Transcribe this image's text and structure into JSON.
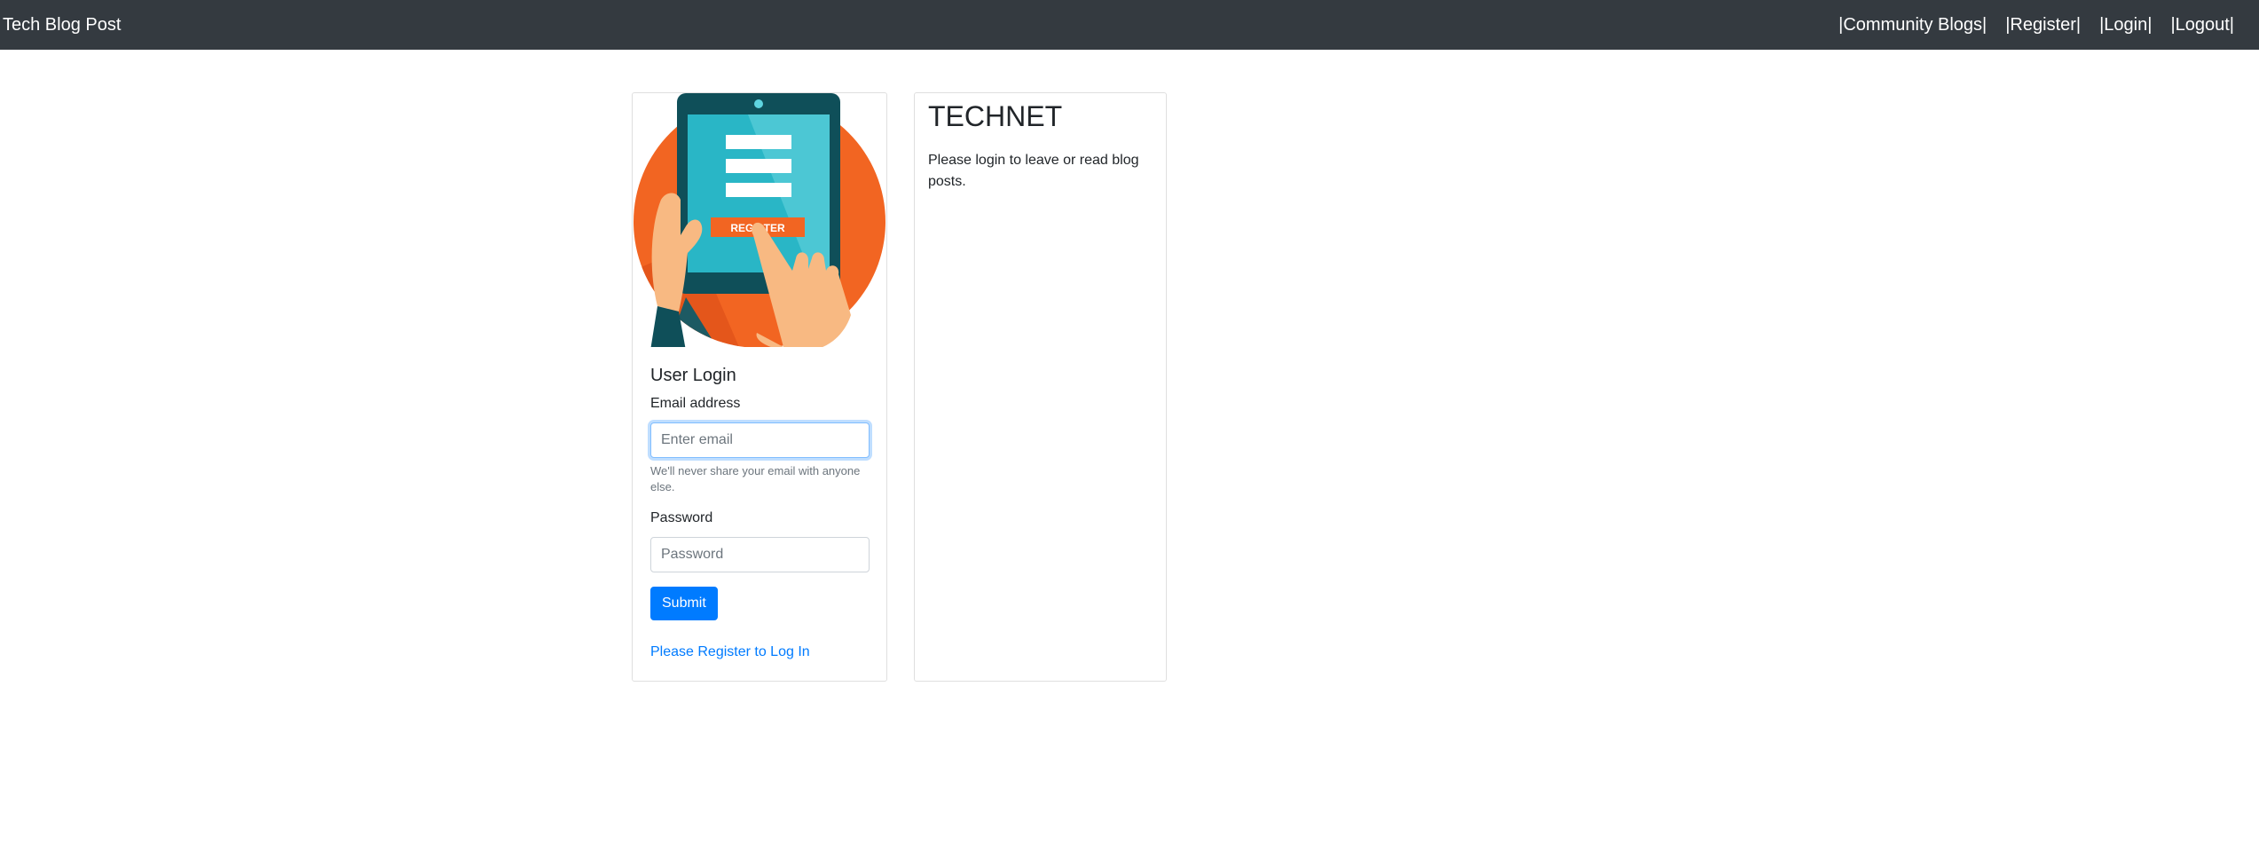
{
  "navbar": {
    "brand": "Tech Blog Post",
    "links": [
      "|Community Blogs|",
      "|Register|",
      "|Login|",
      "|Logout|"
    ],
    "background": "#343a40"
  },
  "login": {
    "illustration_label": "REGISTER",
    "title": "User Login",
    "email_label": "Email address",
    "email_placeholder": "Enter email",
    "email_value": "",
    "email_help": "We'll never share your email with anyone else.",
    "password_label": "Password",
    "password_placeholder": "Password",
    "password_value": "",
    "submit_label": "Submit",
    "register_link": "Please Register to Log In",
    "accent": "#007bff"
  },
  "info": {
    "title": "TECHNET",
    "text": "Please login to leave or read blog posts."
  }
}
